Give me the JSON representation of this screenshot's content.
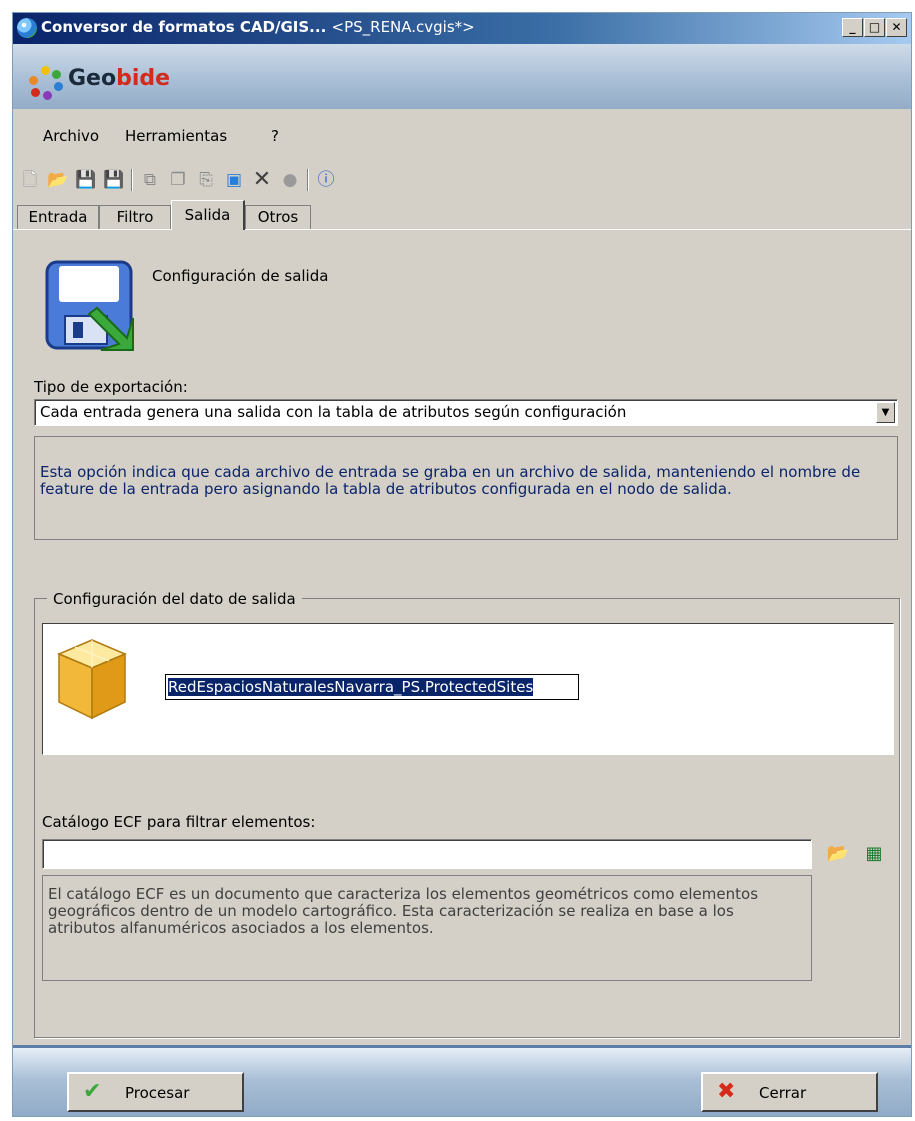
{
  "window": {
    "title_app": "Conversor de formatos CAD/GIS...",
    "title_file": "<PS_RENA.cvgis*>",
    "min_glyph": "_",
    "max_glyph": "□",
    "close_glyph": "✕"
  },
  "brand": {
    "name_part1": "Geo",
    "name_part2": "bide"
  },
  "menu": {
    "archivo": "Archivo",
    "herramientas": "Herramientas",
    "help": "?"
  },
  "toolbar": {
    "icons": [
      "new-file-icon",
      "open-folder-icon",
      "save-icon",
      "save-as-icon",
      "copy-icon",
      "duplicate-icon",
      "paste-icon",
      "properties-icon",
      "delete-icon",
      "record-icon",
      "help-icon"
    ]
  },
  "tabs": [
    {
      "label": "Entrada"
    },
    {
      "label": "Filtro"
    },
    {
      "label": "Salida",
      "active": true
    },
    {
      "label": "Otros"
    }
  ],
  "panel": {
    "title": "Configuración de salida",
    "export_label": "Tipo de exportación:",
    "export_value": "Cada entrada genera una salida con la tabla de atributos según configuración",
    "export_description": "Esta opción indica que cada archivo de entrada se graba en un archivo de salida, manteniendo el nombre de feature de la entrada pero asignando la tabla de atributos configurada en el nodo de salida.",
    "group_title": "Configuración del dato de salida",
    "output_name": "RedEspaciosNaturalesNavarra_PS.ProtectedSites",
    "ecf_label": "Catálogo ECF para filtrar elementos:",
    "ecf_value": "",
    "ecf_description": "El catálogo ECF es un documento que caracteriza los elementos geométricos como elementos geográficos dentro de un modelo cartográfico. Esta caracterización se realiza en base a los atributos alfanuméricos asociados a los elementos."
  },
  "footer": {
    "process_label": "Procesar",
    "close_label": "Cerrar"
  },
  "colors": {
    "title_start": "#0a246a",
    "selection": "#0a246a",
    "description_text": "#0a246a",
    "accent_red": "#d42a1c"
  }
}
